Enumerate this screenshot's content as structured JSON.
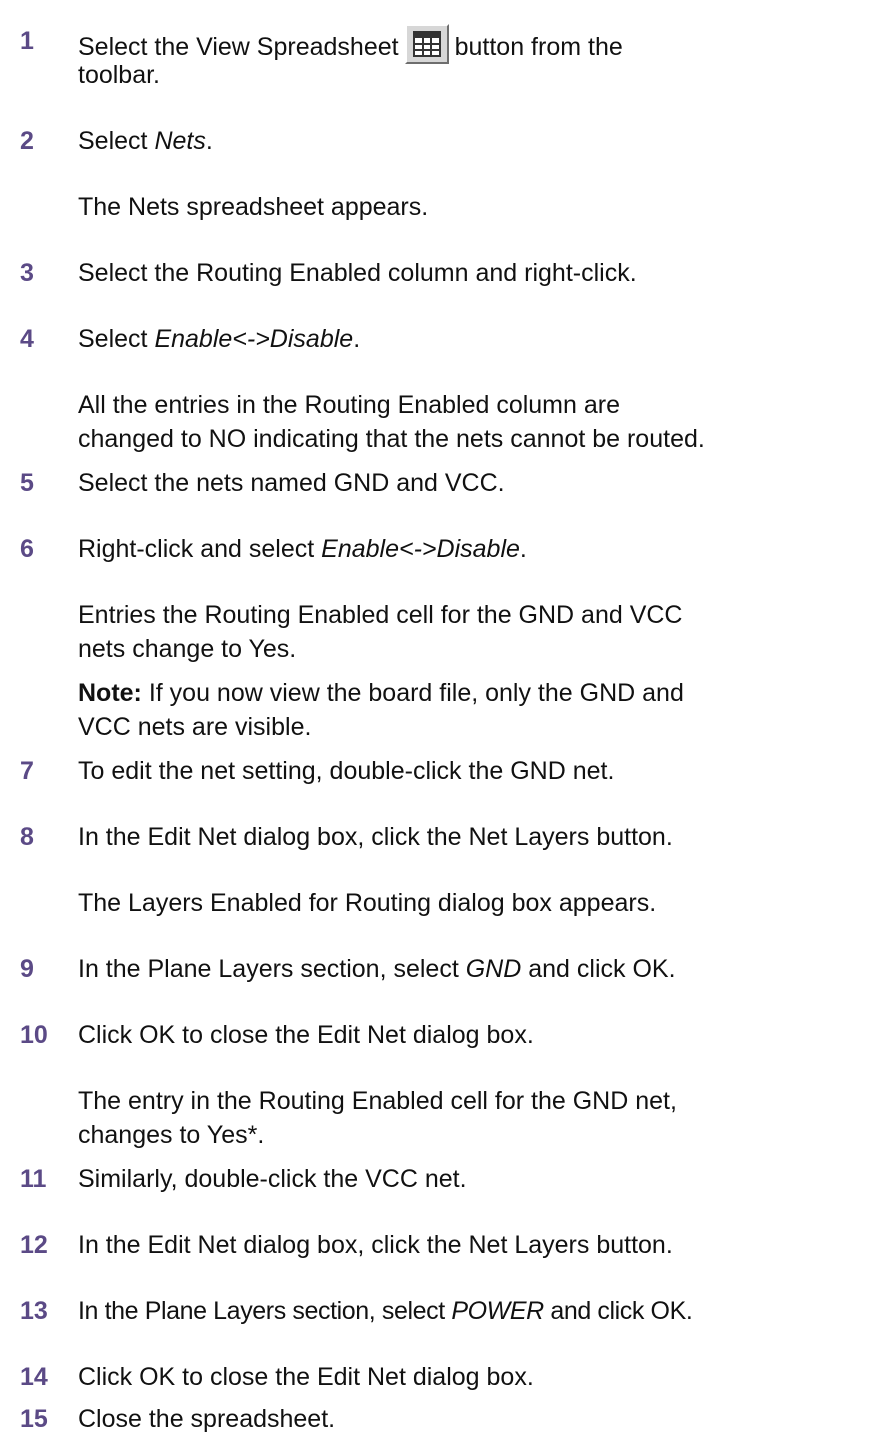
{
  "steps": [
    {
      "num": "1",
      "parts": [
        "Select the View Spreadsheet",
        "button from the",
        "toolbar."
      ],
      "icon": "spreadsheet-grid-icon"
    },
    {
      "num": "2",
      "prefix": "Select ",
      "italic": "Nets",
      "suffix": "."
    },
    {
      "para": "The Nets spreadsheet appears."
    },
    {
      "num": "3",
      "text": "Select the Routing Enabled column and right-click."
    },
    {
      "num": "4",
      "prefix": "Select ",
      "italic": "Enable<->Disable",
      "suffix": "."
    },
    {
      "para_lines": [
        "All the entries in the Routing Enabled column are",
        "changed to NO indicating that the nets cannot be routed."
      ]
    },
    {
      "num": "5",
      "text": "Select the nets named GND and VCC."
    },
    {
      "num": "6",
      "prefix": "Right-click and select ",
      "italic": "Enable<->Disable",
      "suffix": "."
    },
    {
      "para_lines": [
        "Entries the Routing Enabled cell for the GND and VCC",
        "nets change to Yes."
      ]
    },
    {
      "note_label": "Note:",
      "note_lines": [
        " If you now view the board file, only the GND and",
        "VCC nets are visible."
      ]
    },
    {
      "num": "7",
      "text": "To edit the net setting, double-click the GND net."
    },
    {
      "num": "8",
      "text": "In the Edit Net dialog box, click the Net Layers button."
    },
    {
      "para": "The Layers Enabled for Routing dialog box appears."
    },
    {
      "num": "9",
      "prefix": "In the Plane Layers section, select ",
      "italic": "GND",
      "suffix": " and click OK."
    },
    {
      "num": "10",
      "text": "Click OK to close the Edit Net dialog box."
    },
    {
      "para_lines": [
        "The entry in the Routing Enabled cell for the GND net,",
        "changes to Yes*."
      ]
    },
    {
      "num": "11",
      "text": "Similarly, double-click the VCC net."
    },
    {
      "num": "12",
      "text": "In the Edit Net dialog box, click the Net Layers button."
    },
    {
      "num": "13",
      "prefix": "In the Plane Layers section, select ",
      "italic": "POWER",
      "suffix": " and click OK."
    },
    {
      "num": "14",
      "text": "Click OK to close the Edit Net dialog box."
    },
    {
      "num": "15",
      "text": "Close the spreadsheet."
    }
  ],
  "colors": {
    "step_number": "#5b4a86",
    "text": "#111111"
  }
}
